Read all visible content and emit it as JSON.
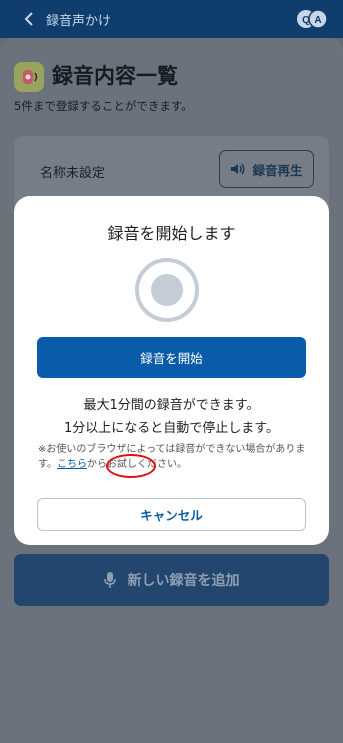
{
  "header": {
    "back_icon": "chevron-left-icon",
    "title": "録音声かけ",
    "qa_icon": "qa-icon",
    "qa_q": "Q",
    "qa_a": "A"
  },
  "page": {
    "title": "録音内容一覧",
    "subtitle": "5件まで登録することができます。",
    "recording_item": {
      "name": "名称未設定",
      "play_label": "録音再生"
    },
    "add_button_label": "新しい録音を追加"
  },
  "modal": {
    "title": "録音を開始します",
    "start_button_label": "録音を開始",
    "message_line1": "最大1分間の録音ができます。",
    "message_line2": "1分以上になると自動で停止します。",
    "note_before_link": "※お使いのブラウザによっては録音ができない場合があります。",
    "note_link": "こちら",
    "note_after_link": "からお試しください。",
    "cancel_label": "キャンセル"
  },
  "colors": {
    "header_bg": "#0f3d6e",
    "primary": "#0a5caa",
    "highlight_circle": "#e01010"
  }
}
